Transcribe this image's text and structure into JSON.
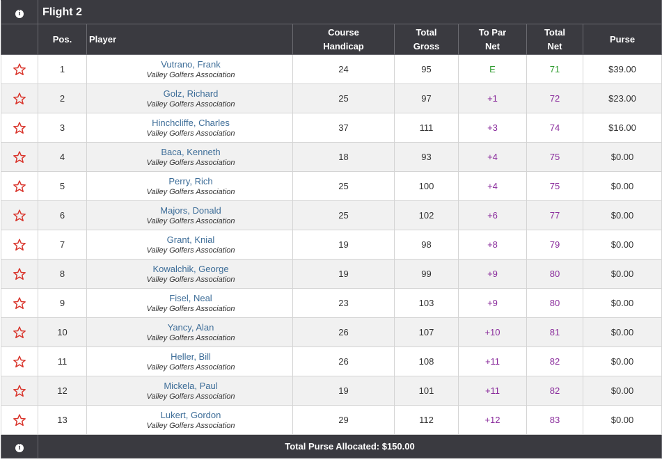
{
  "flight_title": "Flight 2",
  "headers": {
    "pos": "Pos.",
    "player": "Player",
    "course_handicap_1": "Course",
    "course_handicap_2": "Handicap",
    "total_gross_1": "Total",
    "total_gross_2": "Gross",
    "to_par_net_1": "To Par",
    "to_par_net_2": "Net",
    "total_net_1": "Total",
    "total_net_2": "Net",
    "purse": "Purse"
  },
  "rows": [
    {
      "pos": "1",
      "name": "Vutrano, Frank",
      "assoc": "Valley Golfers Association",
      "handicap": "24",
      "gross": "95",
      "to_par": "E",
      "net": "71",
      "purse": "$39.00"
    },
    {
      "pos": "2",
      "name": "Golz, Richard",
      "assoc": "Valley Golfers Association",
      "handicap": "25",
      "gross": "97",
      "to_par": "+1",
      "net": "72",
      "purse": "$23.00"
    },
    {
      "pos": "3",
      "name": "Hinchcliffe, Charles",
      "assoc": "Valley Golfers Association",
      "handicap": "37",
      "gross": "111",
      "to_par": "+3",
      "net": "74",
      "purse": "$16.00"
    },
    {
      "pos": "4",
      "name": "Baca, Kenneth",
      "assoc": "Valley Golfers Association",
      "handicap": "18",
      "gross": "93",
      "to_par": "+4",
      "net": "75",
      "purse": "$0.00"
    },
    {
      "pos": "5",
      "name": "Perry, Rich",
      "assoc": "Valley Golfers Association",
      "handicap": "25",
      "gross": "100",
      "to_par": "+4",
      "net": "75",
      "purse": "$0.00"
    },
    {
      "pos": "6",
      "name": "Majors, Donald",
      "assoc": "Valley Golfers Association",
      "handicap": "25",
      "gross": "102",
      "to_par": "+6",
      "net": "77",
      "purse": "$0.00"
    },
    {
      "pos": "7",
      "name": "Grant, Knial",
      "assoc": "Valley Golfers Association",
      "handicap": "19",
      "gross": "98",
      "to_par": "+8",
      "net": "79",
      "purse": "$0.00"
    },
    {
      "pos": "8",
      "name": "Kowalchik, George",
      "assoc": "Valley Golfers Association",
      "handicap": "19",
      "gross": "99",
      "to_par": "+9",
      "net": "80",
      "purse": "$0.00"
    },
    {
      "pos": "9",
      "name": "Fisel, Neal",
      "assoc": "Valley Golfers Association",
      "handicap": "23",
      "gross": "103",
      "to_par": "+9",
      "net": "80",
      "purse": "$0.00"
    },
    {
      "pos": "10",
      "name": "Yancy, Alan",
      "assoc": "Valley Golfers Association",
      "handicap": "26",
      "gross": "107",
      "to_par": "+10",
      "net": "81",
      "purse": "$0.00"
    },
    {
      "pos": "11",
      "name": "Heller, Bill",
      "assoc": "Valley Golfers Association",
      "handicap": "26",
      "gross": "108",
      "to_par": "+11",
      "net": "82",
      "purse": "$0.00"
    },
    {
      "pos": "12",
      "name": "Mickela, Paul",
      "assoc": "Valley Golfers Association",
      "handicap": "19",
      "gross": "101",
      "to_par": "+11",
      "net": "82",
      "purse": "$0.00"
    },
    {
      "pos": "13",
      "name": "Lukert, Gordon",
      "assoc": "Valley Golfers Association",
      "handicap": "29",
      "gross": "112",
      "to_par": "+12",
      "net": "83",
      "purse": "$0.00"
    }
  ],
  "footer": {
    "total_purse": "Total Purse Allocated: $150.00"
  },
  "icons": {
    "info": "info-icon",
    "favorite": "star-outline-icon"
  },
  "colors": {
    "header_bg": "#3a3a40",
    "player_link": "#3d6d98",
    "even_par": "#2e9b2e",
    "over_par": "#8a2c9c",
    "star": "#d9342b"
  }
}
